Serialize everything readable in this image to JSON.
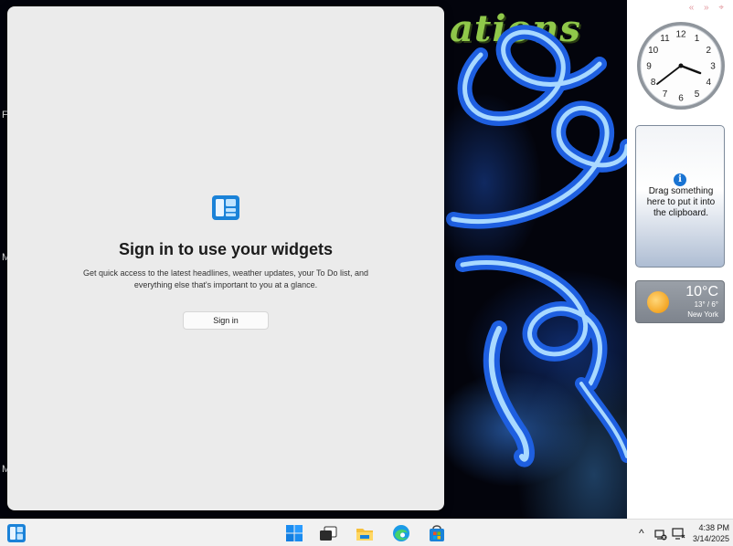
{
  "wallpaper": {
    "title_fragment": "ations"
  },
  "widgets": {
    "heading": "Sign in to use your widgets",
    "description": "Get quick access to the latest headlines, weather updates, your To Do list, and everything else that's important to you at a glance.",
    "signin_label": "Sign in"
  },
  "gadgets": {
    "controls": "« » ⌖",
    "clock": {
      "numbers": [
        "12",
        "1",
        "2",
        "3",
        "4",
        "5",
        "6",
        "7",
        "8",
        "9",
        "10",
        "11"
      ],
      "time": "4:38"
    },
    "clipboard": {
      "info_glyph": "i",
      "text": "Drag something here to put it into the clipboard."
    },
    "weather": {
      "temp": "10°C",
      "range": "13° / 6°",
      "city": "New York"
    }
  },
  "taskbar": {
    "time": "4:38 PM",
    "date": "3/14/2025",
    "icons": [
      "widgets-icon",
      "start-icon",
      "task-view-icon",
      "file-explorer-icon",
      "edge-icon",
      "store-icon"
    ],
    "tray_chevron": "^"
  },
  "colors": {
    "accent": "#0067c0",
    "panel_bg": "#ebebeb",
    "wall_title": "#8fc84a"
  }
}
